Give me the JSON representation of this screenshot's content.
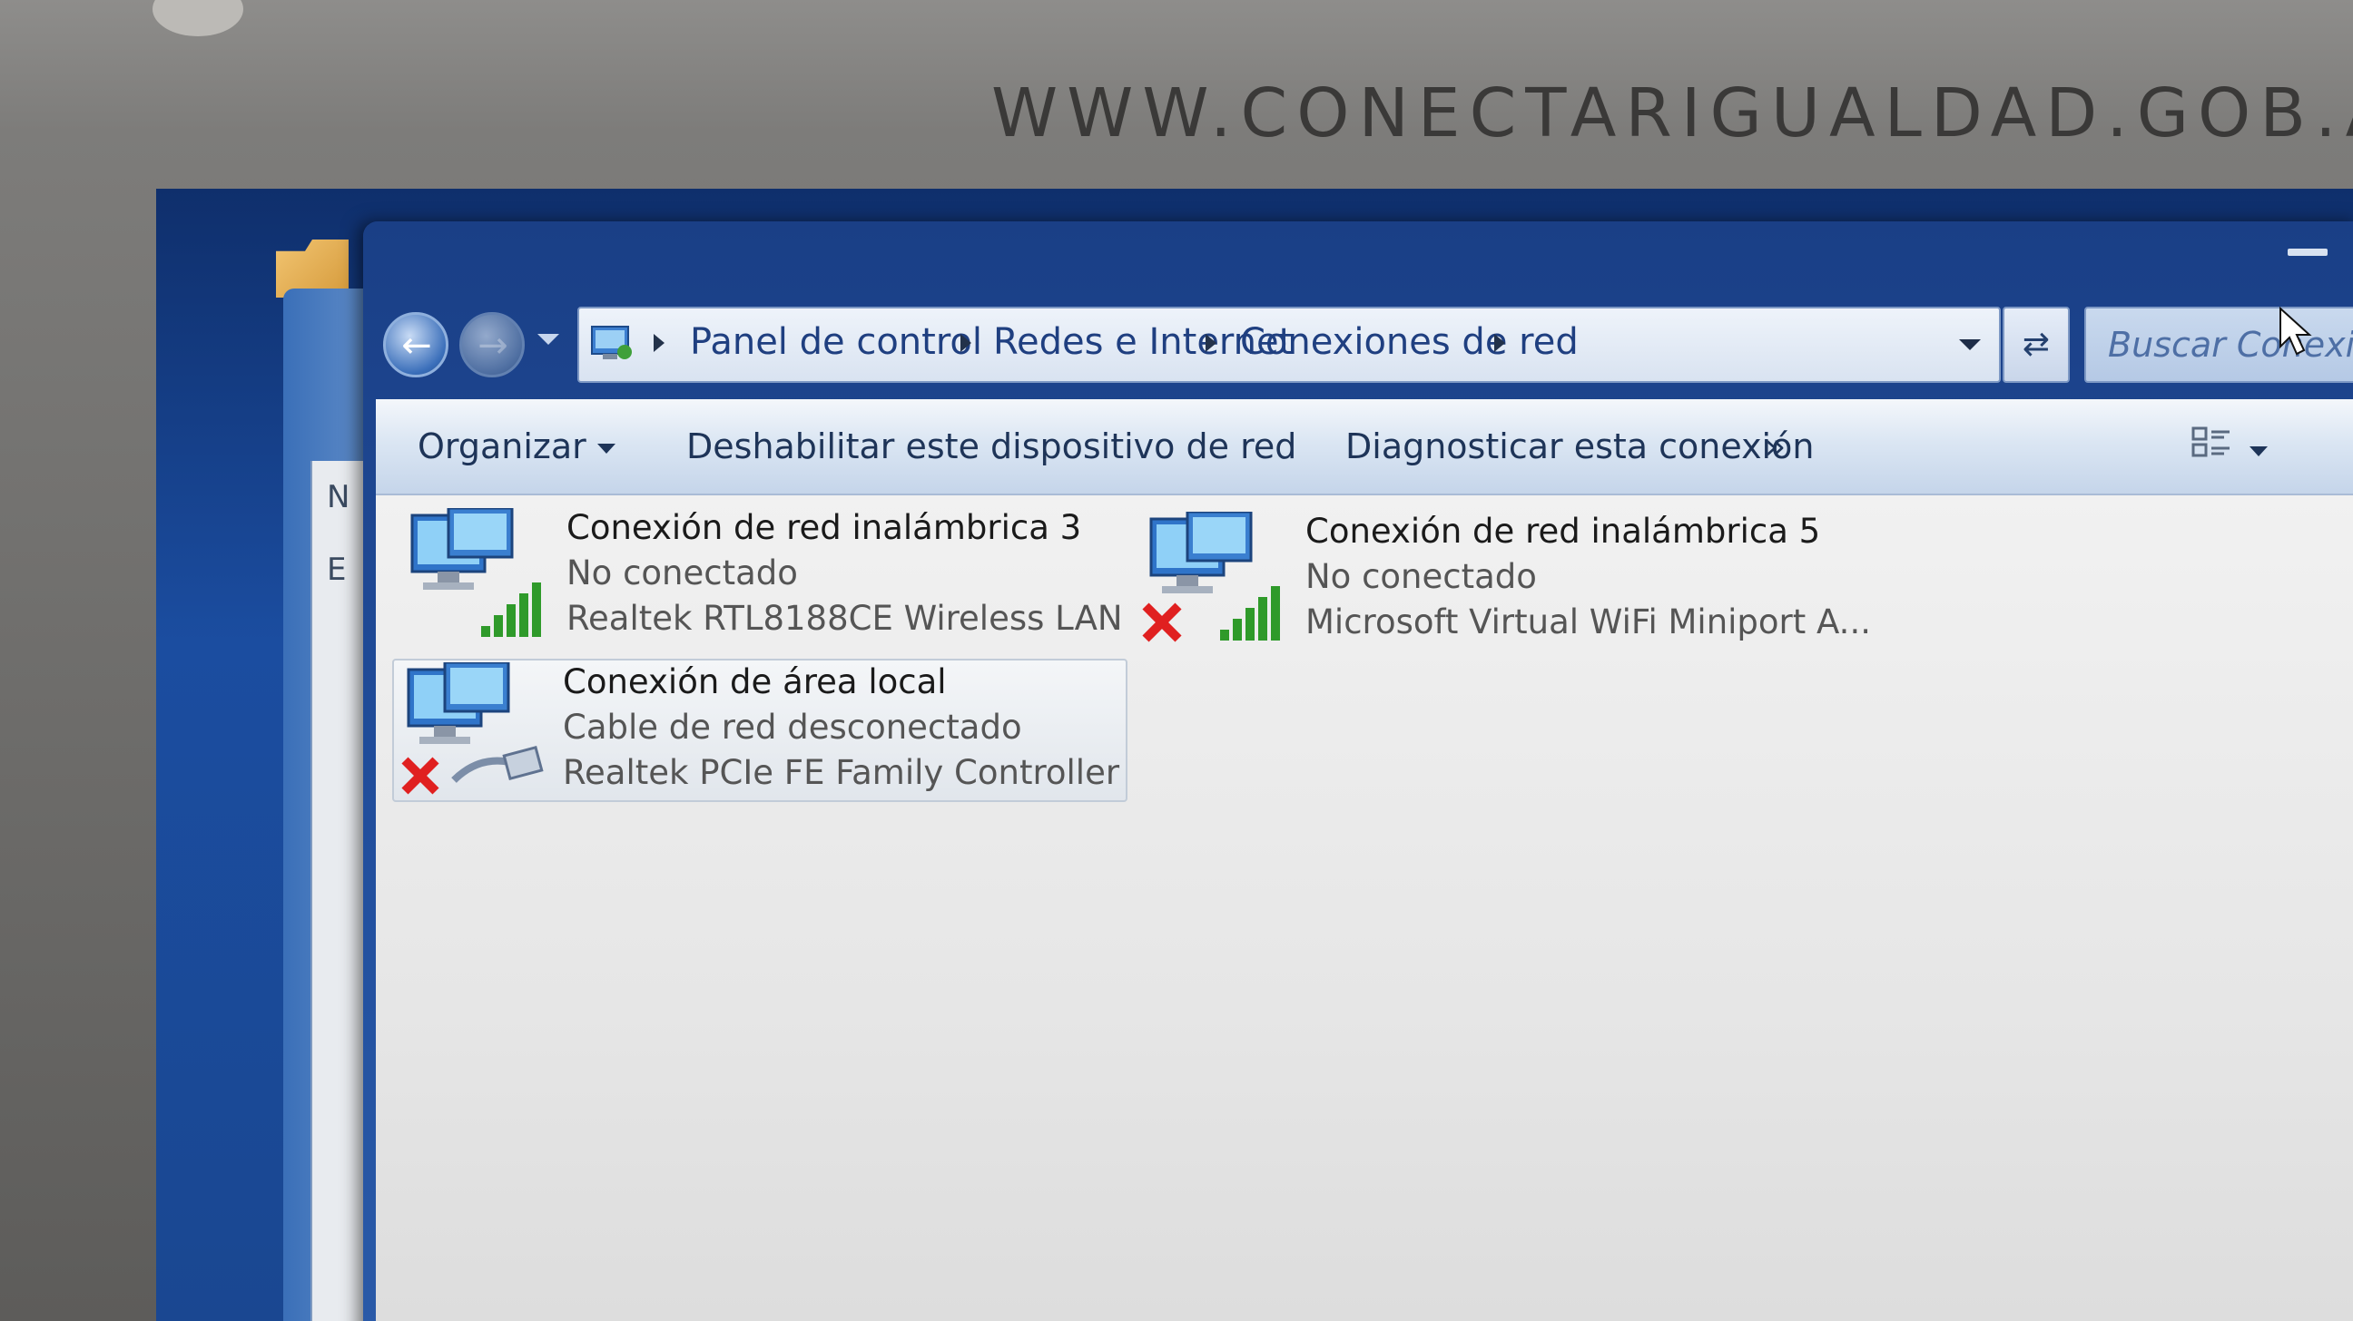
{
  "bezel": {
    "url_text": "WWW.CONECTARIGUALDAD.GOB.AR"
  },
  "navigation": {
    "breadcrumbs": [
      "Panel de control",
      "Redes e Internet",
      "Conexiones de red"
    ],
    "search_placeholder": "Buscar Conexiones de"
  },
  "command_bar": {
    "organize_label": "Organizar",
    "disable_label": "Deshabilitar este dispositivo de red",
    "diagnose_label": "Diagnosticar esta conexión",
    "more_label": "»"
  },
  "connections": [
    {
      "name": "Conexión de red inalámbrica 3",
      "status": "No conectado",
      "adapter": "Realtek RTL8188CE Wireless LAN ...",
      "type": "wireless",
      "disconnected_mark": false
    },
    {
      "name": "Conexión de red inalámbrica 5",
      "status": "No conectado",
      "adapter": "Microsoft Virtual WiFi Miniport A...",
      "type": "wireless",
      "disconnected_mark": true
    },
    {
      "name": "Conexión de área local",
      "status": "Cable de red desconectado",
      "adapter": "Realtek PCIe FE Family Controller",
      "type": "ethernet",
      "disconnected_mark": true
    }
  ],
  "colors": {
    "title_bar": "#1a3f86",
    "link_blue": "#1f3f80",
    "error_red": "#e02020",
    "signal_green": "#2f9a2a"
  },
  "icons": [
    "back-arrow-icon",
    "forward-arrow-icon",
    "control-panel-icon",
    "refresh-icon",
    "view-options-icon",
    "network-computer-icon",
    "signal-bars-icon",
    "ethernet-cable-icon",
    "red-x-icon",
    "mouse-cursor-icon"
  ]
}
